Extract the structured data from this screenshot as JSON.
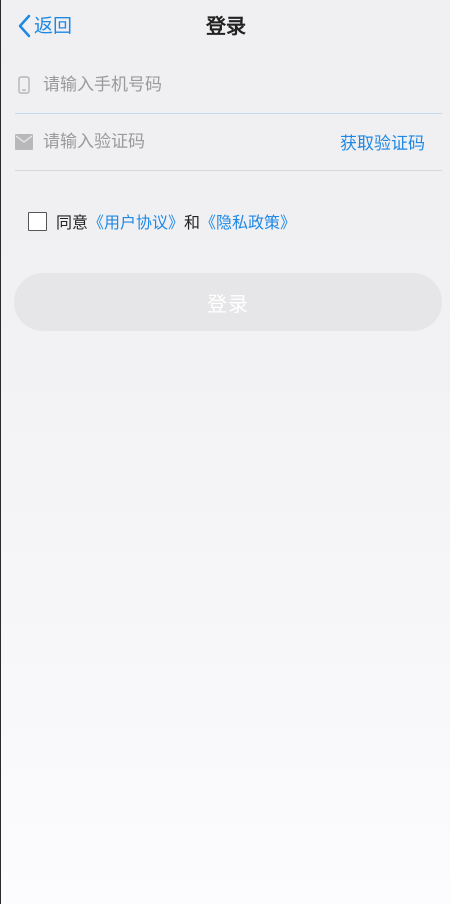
{
  "navbar": {
    "back_label": "返回",
    "title": "登录"
  },
  "form": {
    "phone_placeholder": "请输入手机号码",
    "code_placeholder": "请输入验证码",
    "get_code_label": "获取验证码"
  },
  "agreement": {
    "prefix": "同意",
    "user_agreement": "《用户协议》",
    "conjunction": "和",
    "privacy_policy": "《隐私政策》"
  },
  "login_button": "登录",
  "colors": {
    "accent": "#1e88e5",
    "button_bg": "#e6e6e8"
  },
  "icons": {
    "back": "chevron-left-icon",
    "phone": "phone-icon",
    "code": "message-icon"
  }
}
